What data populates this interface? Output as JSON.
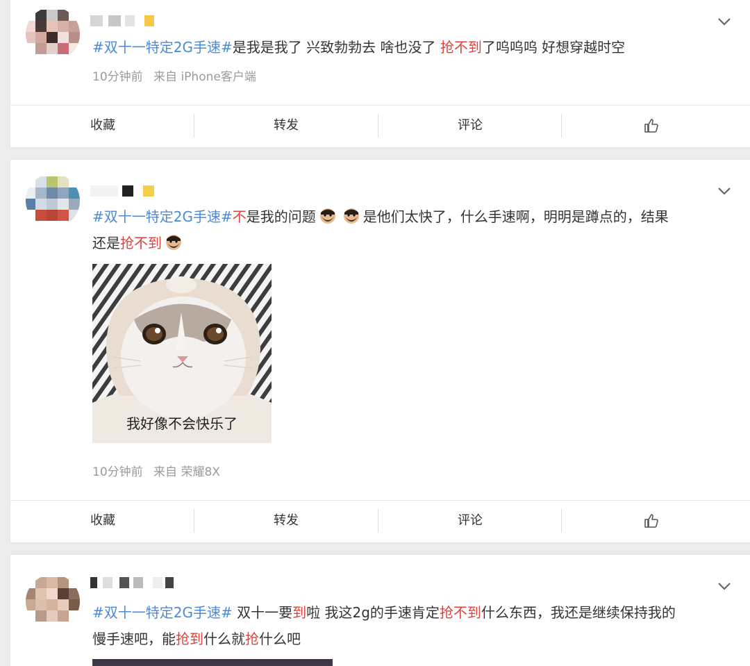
{
  "posts": [
    {
      "hashtag": "#双十一特定2G手速#",
      "text_parts": [
        "是我是我了 兴致勃勃去 啥也没了 ",
        "抢不到",
        "了呜呜呜 好想穿越时空"
      ],
      "time": "10分钟前",
      "source": "来自 iPhone客户端"
    },
    {
      "hashtag": "#双十一特定2G手速#",
      "line1_parts": [
        "不",
        "是我的问题",
        "是他们太快了，什么手速啊，明明是蹲点的，结果"
      ],
      "line2_parts": [
        "还是",
        "抢不到"
      ],
      "image_caption": "我好像不会快乐了",
      "time": "10分钟前",
      "source": "来自 荣耀8X"
    },
    {
      "hashtag": "#双十一特定2G手速#",
      "line1_parts": [
        " 双十一要",
        "到",
        "啦 我这2g的手速肯定",
        "抢不到",
        "什么东西，我还是继续保持我的"
      ],
      "line2_parts": [
        "慢手速吧，能",
        "抢到",
        "什么就",
        "抢",
        "什么吧"
      ]
    }
  ],
  "actions": {
    "favorite": "收藏",
    "repost": "转发",
    "comment": "评论",
    "like_icon": "thumbs-up-icon"
  },
  "icons": {
    "chevron": "chevron-down-icon",
    "emoji": "bearded-face-emoji"
  },
  "colors": {
    "hashtag": "#4b8ad7",
    "highlight": "#e0423a",
    "meta": "#9a9a9a"
  }
}
